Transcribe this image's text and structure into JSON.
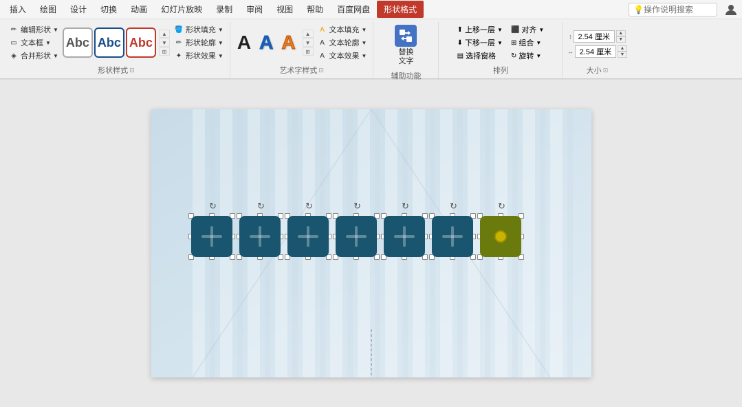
{
  "tabs": {
    "items": [
      {
        "label": "插入",
        "active": false
      },
      {
        "label": "绘图",
        "active": false
      },
      {
        "label": "设计",
        "active": false
      },
      {
        "label": "切换",
        "active": false
      },
      {
        "label": "动画",
        "active": false
      },
      {
        "label": "幻灯片放映",
        "active": false
      },
      {
        "label": "录制",
        "active": false
      },
      {
        "label": "审阅",
        "active": false
      },
      {
        "label": "视图",
        "active": false
      },
      {
        "label": "帮助",
        "active": false
      },
      {
        "label": "百度网盘",
        "active": false
      },
      {
        "label": "形状格式",
        "active": true
      },
      {
        "label": "操作说明搜索",
        "active": false
      }
    ]
  },
  "ribbon": {
    "shape_styles_group": {
      "label": "形状样式",
      "sub_items": [
        {
          "label": "形状填充"
        },
        {
          "label": "形状轮廓"
        },
        {
          "label": "形状效果"
        }
      ],
      "expand_icon": "⊡"
    },
    "art_word_group": {
      "label": "艺术字样式",
      "sub_items": [
        {
          "label": "文本填充"
        },
        {
          "label": "文本轮廓"
        },
        {
          "label": "文本效果"
        }
      ],
      "letters": [
        "A",
        "A",
        "A"
      ],
      "expand_icon": "⊡"
    },
    "assist_group": {
      "label": "辅助功能",
      "replace_label": "替换\n文字"
    },
    "arrange_group": {
      "label": "排列",
      "col1": [
        {
          "label": "上移一层"
        },
        {
          "label": "下移一层"
        },
        {
          "label": "选择窗格"
        }
      ],
      "col2": [
        {
          "label": "对齐"
        },
        {
          "label": "组合"
        },
        {
          "label": "旋转"
        }
      ]
    },
    "size_group": {
      "label": "大小",
      "height_value": "2.54 厘米",
      "width_value": "2.54 厘米",
      "expand_icon": "⊡"
    }
  },
  "shapes": {
    "count": 7,
    "color": "#1a5570",
    "last_color": "#8a9a10"
  }
}
